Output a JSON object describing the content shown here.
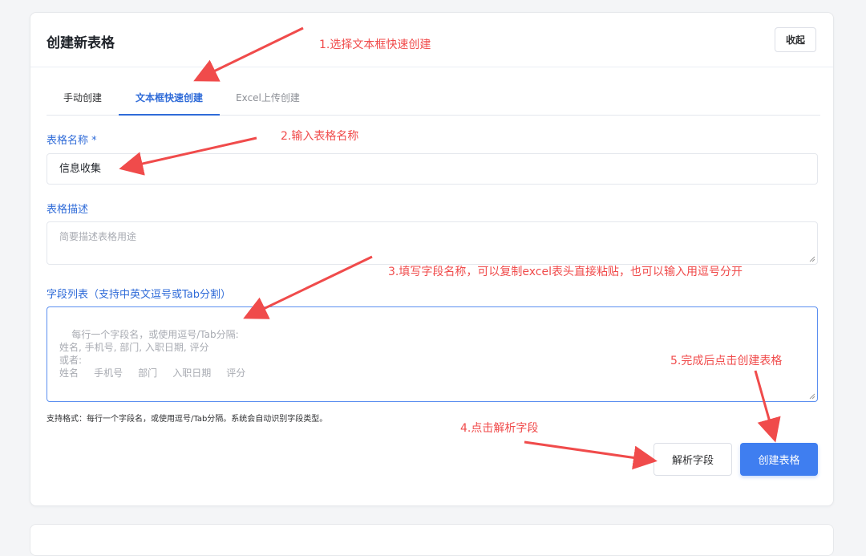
{
  "header": {
    "title": "创建新表格",
    "collapse_label": "收起"
  },
  "tabs": [
    {
      "label": "手动创建",
      "active": false
    },
    {
      "label": "文本框快速创建",
      "active": true
    },
    {
      "label": "Excel上传创建",
      "active": false
    }
  ],
  "form": {
    "name_label": "表格名称 *",
    "name_value": "信息收集",
    "desc_label": "表格描述",
    "desc_placeholder": "简要描述表格用途",
    "fields_label": "字段列表（支持中英文逗号或Tab分割）",
    "fields_placeholder": "每行一个字段名，或使用逗号/Tab分隔:\n姓名, 手机号, 部门, 入职日期, 评分\n或者:\n姓名     手机号     部门     入职日期     评分",
    "hint": "支持格式：每行一个字段名，或使用逗号/Tab分隔。系统会自动识别字段类型。"
  },
  "actions": {
    "parse_label": "解析字段",
    "create_label": "创建表格"
  },
  "annotations": [
    "1.选择文本框快速创建",
    "2.输入表格名称",
    "3.填写字段名称，可以复制excel表头直接粘贴，也可以输入用逗号分开",
    "4.点击解析字段",
    "5.完成后点击创建表格"
  ],
  "colors": {
    "accent": "#3f7ef0",
    "annotation": "#f04b4b"
  }
}
